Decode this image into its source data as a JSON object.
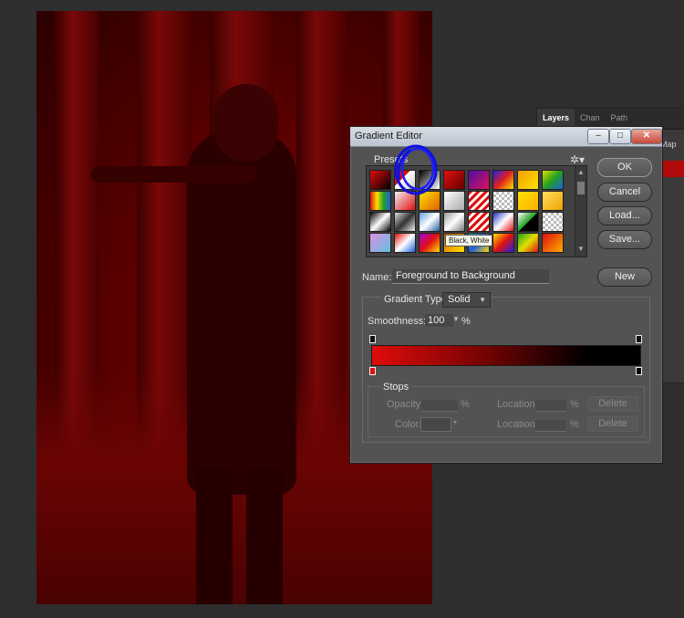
{
  "dialog": {
    "title": "Gradient Editor",
    "close_label": "✕",
    "presets_label": "Presets",
    "tooltip": "Black, White",
    "name_label": "Name:",
    "name_value": "Foreground to Background",
    "buttons": {
      "ok": "OK",
      "cancel": "Cancel",
      "load": "Load...",
      "save": "Save...",
      "new": "New"
    },
    "gradient_type_label": "Gradient Type:",
    "gradient_type_value": "Solid",
    "smoothness_label": "Smoothness:",
    "smoothness_value": "100",
    "smoothness_unit": "%",
    "stops": {
      "label": "Stops",
      "opacity_label": "Opacity:",
      "opacity_unit": "%",
      "color_label": "Color:",
      "location_label": "Location:",
      "location_unit": "%",
      "delete_label": "Delete"
    }
  },
  "layers_panel": {
    "tabs": [
      "Layers",
      "Chan",
      "Path"
    ],
    "map_label": "Map"
  },
  "colors": {
    "gradient_start": "#e00c0c",
    "gradient_end": "#000000",
    "annotation": "#1010e0"
  }
}
